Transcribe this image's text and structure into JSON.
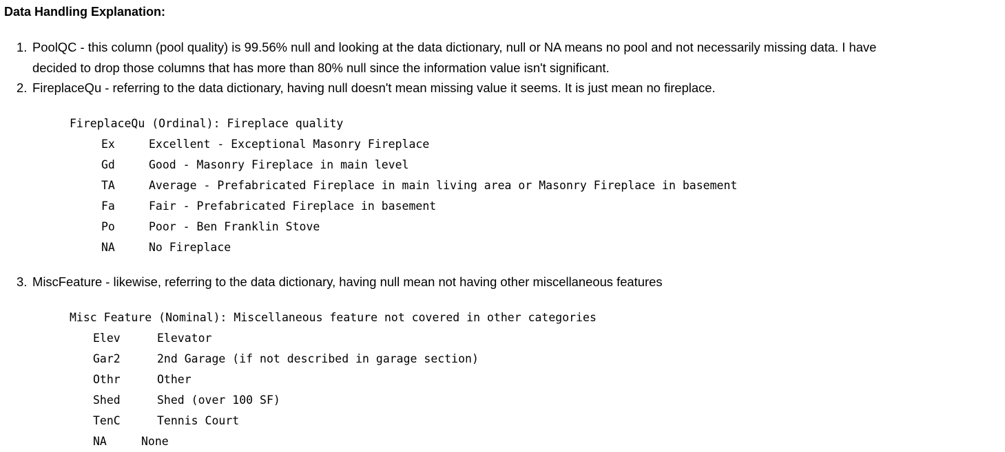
{
  "heading": "Data Handling Explanation:",
  "items": [
    {
      "number": "1.",
      "line1": "PoolQC - this column (pool quality) is 99.56% null and looking at the data dictionary, null or NA means no pool and not necessarily missing data. I have",
      "line2": "decided to drop those columns that has more than 80% null since the information value isn't significant."
    },
    {
      "number": "2.",
      "line1": "FireplaceQu - referring to the data dictionary, having null doesn't mean missing value it seems. It is just mean no fireplace."
    },
    {
      "number": "3.",
      "line1": "MiscFeature - likewise, referring to the data dictionary, having null mean not having other miscellaneous features"
    }
  ],
  "fireplace_block": {
    "title": "FireplaceQu (Ordinal): Fireplace quality",
    "rows": [
      {
        "code": "Ex",
        "desc": "Excellent - Exceptional Masonry Fireplace"
      },
      {
        "code": "Gd",
        "desc": "Good - Masonry Fireplace in main level"
      },
      {
        "code": "TA",
        "desc": "Average - Prefabricated Fireplace in main living area or Masonry Fireplace in basement"
      },
      {
        "code": "Fa",
        "desc": "Fair - Prefabricated Fireplace in basement"
      },
      {
        "code": "Po",
        "desc": "Poor - Ben Franklin Stove"
      },
      {
        "code": "NA",
        "desc": "No Fireplace"
      }
    ]
  },
  "misc_block": {
    "title": "Misc Feature (Nominal): Miscellaneous feature not covered in other categories",
    "rows": [
      {
        "code": "Elev",
        "desc": "Elevator"
      },
      {
        "code": "Gar2",
        "desc": "2nd Garage (if not described in garage section)"
      },
      {
        "code": "Othr",
        "desc": "Other"
      },
      {
        "code": "Shed",
        "desc": "Shed (over 100 SF)"
      },
      {
        "code": "TenC",
        "desc": "Tennis Court"
      },
      {
        "code": "NA",
        "desc": "None"
      }
    ]
  }
}
